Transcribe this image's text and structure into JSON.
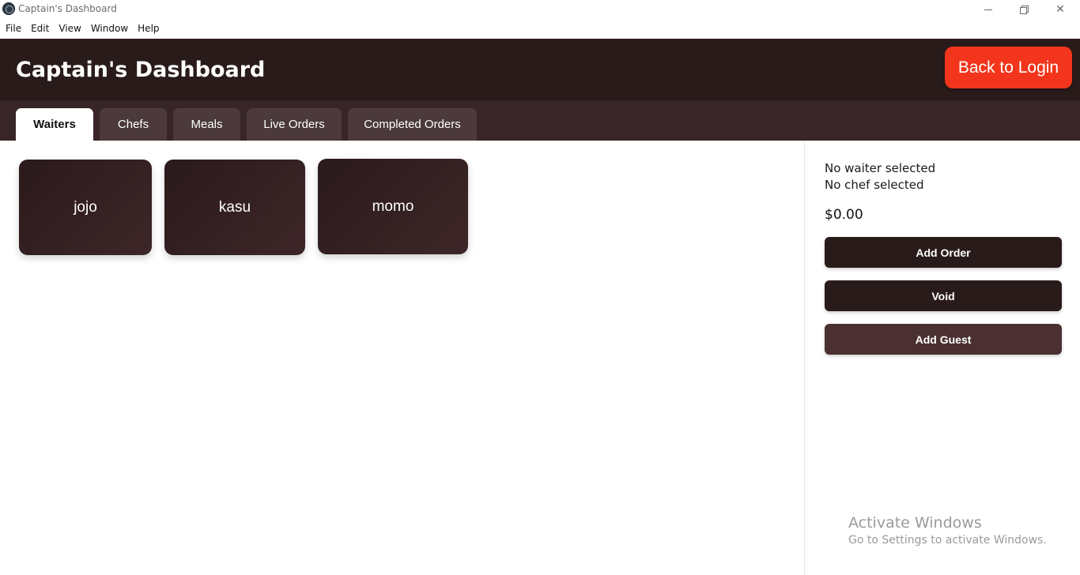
{
  "window": {
    "title": "Captain's Dashboard",
    "controls": {
      "minimize_icon": "minimize-icon",
      "restore_icon": "restore-icon",
      "close_icon": "close-icon",
      "close_glyph": "✕"
    }
  },
  "menu": [
    "File",
    "Edit",
    "View",
    "Window",
    "Help"
  ],
  "header": {
    "title": "Captain's Dashboard",
    "back_label": "Back to Login",
    "background": "#2a1b1b",
    "back_color": "#f2351c"
  },
  "tabs": [
    {
      "label": "Waiters",
      "active": true
    },
    {
      "label": "Chefs",
      "active": false
    },
    {
      "label": "Meals",
      "active": false
    },
    {
      "label": "Live Orders",
      "active": false
    },
    {
      "label": "Completed Orders",
      "active": false
    }
  ],
  "waiters": [
    {
      "name": "jojo"
    },
    {
      "name": "kasu"
    },
    {
      "name": "momo"
    }
  ],
  "sidebar": {
    "waiter_status": "No waiter selected",
    "chef_status": "No chef selected",
    "total": "$0.00",
    "add_order_label": "Add Order",
    "void_label": "Void",
    "add_guest_label": "Add Guest",
    "primary_button_color": "#2a1b1b",
    "secondary_button_color": "#4b3031"
  },
  "watermark": {
    "title": "Activate Windows",
    "subtitle": "Go to Settings to activate Windows."
  }
}
